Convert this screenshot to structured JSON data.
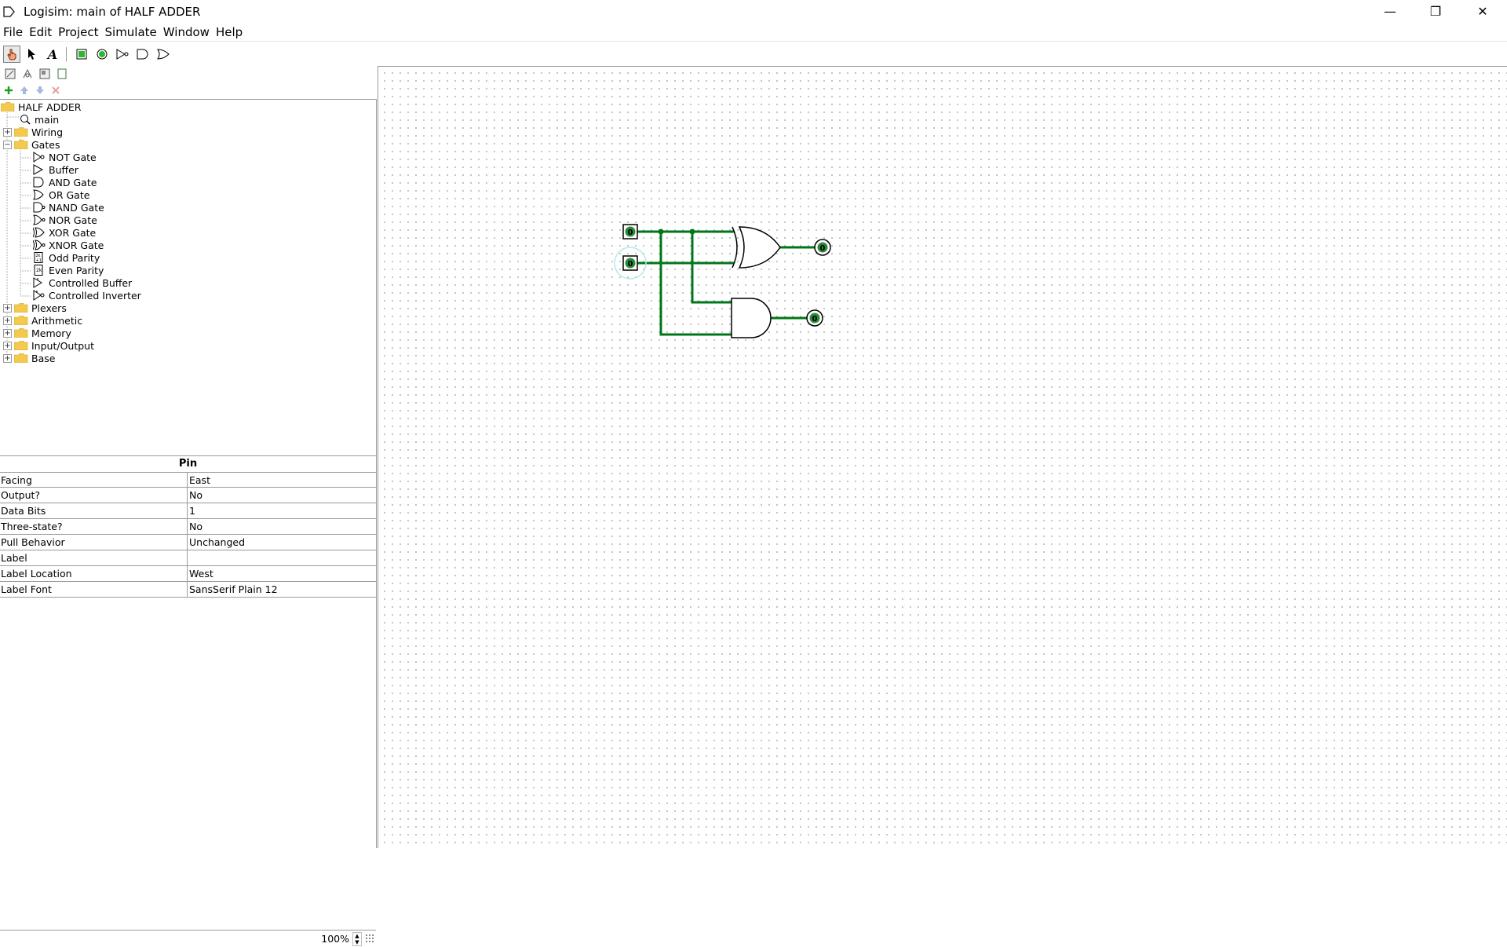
{
  "window": {
    "title": "Logisim: main of HALF ADDER",
    "minimize": "—",
    "maximize": "❐",
    "close": "✕"
  },
  "menu": [
    "File",
    "Edit",
    "Project",
    "Simulate",
    "Window",
    "Help"
  ],
  "toolbar": {
    "tools": [
      "poke-tool",
      "select-tool",
      "text-tool",
      "input-pin",
      "output-pin",
      "not-gate",
      "and-gate",
      "or-gate"
    ],
    "text_tool_glyph": "A"
  },
  "tree": {
    "project": "HALF ADDER",
    "circuit": "main",
    "libraries": [
      {
        "name": "Wiring",
        "expanded": false
      },
      {
        "name": "Gates",
        "expanded": true,
        "items": [
          "NOT Gate",
          "Buffer",
          "AND Gate",
          "OR Gate",
          "NAND Gate",
          "NOR Gate",
          "XOR Gate",
          "XNOR Gate",
          "Odd Parity",
          "Even Parity",
          "Controlled Buffer",
          "Controlled Inverter"
        ]
      },
      {
        "name": "Plexers",
        "expanded": false
      },
      {
        "name": "Arithmetic",
        "expanded": false
      },
      {
        "name": "Memory",
        "expanded": false
      },
      {
        "name": "Input/Output",
        "expanded": false
      },
      {
        "name": "Base",
        "expanded": false
      }
    ]
  },
  "attributes": {
    "title": "Pin",
    "rows": [
      {
        "name": "Facing",
        "value": "East"
      },
      {
        "name": "Output?",
        "value": "No"
      },
      {
        "name": "Data Bits",
        "value": "1"
      },
      {
        "name": "Three-state?",
        "value": "No"
      },
      {
        "name": "Pull Behavior",
        "value": "Unchanged"
      },
      {
        "name": "Label",
        "value": ""
      },
      {
        "name": "Label Location",
        "value": "West"
      },
      {
        "name": "Label Font",
        "value": "SansSerif Plain 12"
      }
    ]
  },
  "zoom": "100%",
  "circuit": {
    "input_a": "0",
    "input_b": "0",
    "sum_output": "0",
    "carry_output": "0",
    "wire_color": "#00761a"
  }
}
